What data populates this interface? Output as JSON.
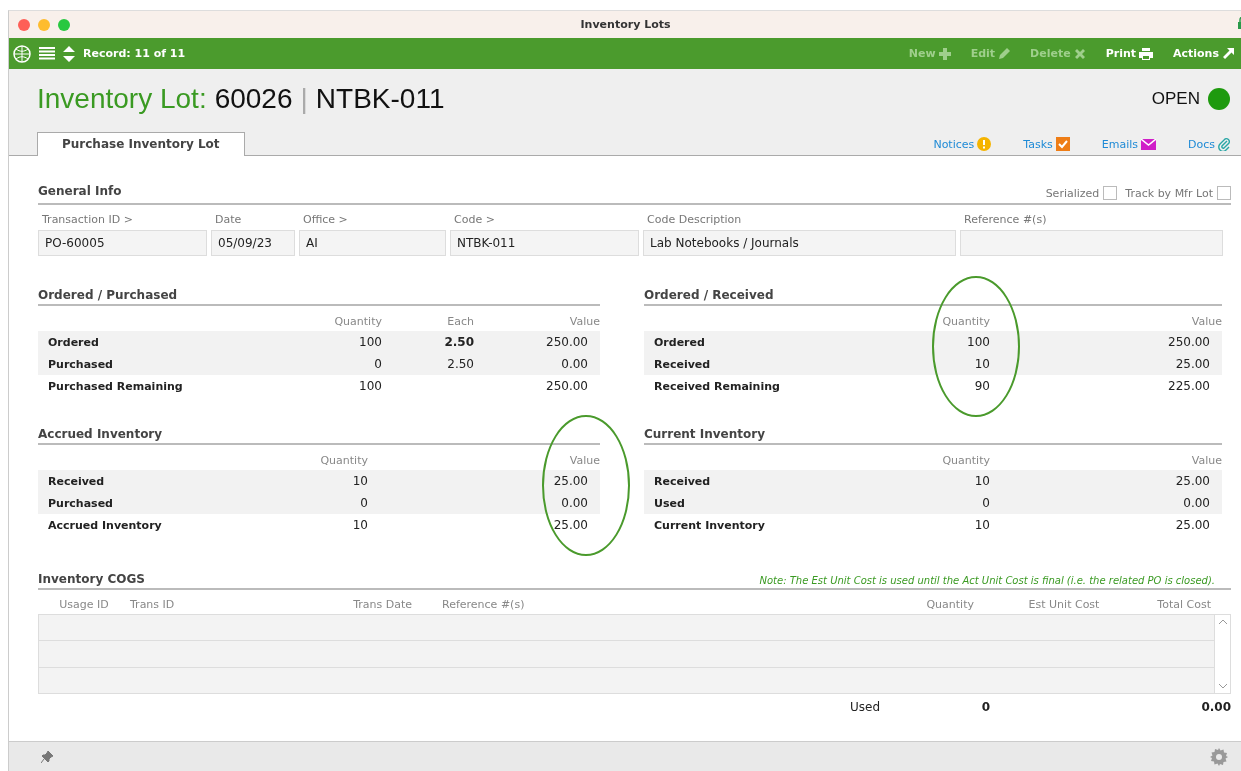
{
  "window": {
    "title": "Inventory Lots"
  },
  "toolbar": {
    "record": "Record: 11 of 11",
    "actions": [
      {
        "label": "New",
        "kind": "plus",
        "disabled": true
      },
      {
        "label": "Edit",
        "kind": "pencil",
        "disabled": true
      },
      {
        "label": "Delete",
        "kind": "cross",
        "disabled": true
      },
      {
        "label": "Print",
        "kind": "printer",
        "disabled": false
      },
      {
        "label": "Actions",
        "kind": "arrow",
        "disabled": false
      }
    ]
  },
  "header": {
    "prefix": "Inventory Lot:",
    "number": "60026",
    "separator": "|",
    "code": "NTBK-011",
    "status": "OPEN"
  },
  "tabs": [
    {
      "label": "Purchase Inventory Lot",
      "selected": true
    }
  ],
  "links": [
    {
      "label": "Notices",
      "kind": "notice"
    },
    {
      "label": "Tasks",
      "kind": "task"
    },
    {
      "label": "Emails",
      "kind": "email"
    },
    {
      "label": "Docs",
      "kind": "doc"
    }
  ],
  "general_info": {
    "title": "General Info",
    "checkboxes": [
      {
        "label": "Serialized",
        "checked": false
      },
      {
        "label": "Track by Mfr Lot",
        "checked": false
      }
    ],
    "fields": [
      {
        "label": "Transaction ID >",
        "value": "PO-60005"
      },
      {
        "label": "Date",
        "value": "05/09/23"
      },
      {
        "label": "Office >",
        "value": "AI"
      },
      {
        "label": "Code >",
        "value": "NTBK-011"
      },
      {
        "label": "Code Description",
        "value": "Lab Notebooks / Journals"
      },
      {
        "label": "Reference #(s)"
      }
    ]
  },
  "sections": [
    {
      "title": "Ordered / Purchased",
      "columns": [
        {
          "label": "Quantity",
          "circled": false
        },
        {
          "label": "Each",
          "circled": false
        },
        {
          "label": "Value",
          "circled": false
        }
      ],
      "rows": [
        {
          "label": "Ordered",
          "shaded": true,
          "cells": [
            {
              "text": "100",
              "bold": false
            },
            {
              "text": "2.50",
              "bold": true
            },
            {
              "text": "250.00",
              "bold": false
            }
          ]
        },
        {
          "label": "Purchased",
          "shaded": true,
          "cells": [
            {
              "text": "0",
              "bold": false
            },
            {
              "text": "2.50",
              "bold": false
            },
            {
              "text": "0.00",
              "bold": false
            }
          ]
        },
        {
          "label": "Purchased Remaining",
          "shaded": false,
          "cells": [
            {
              "text": "100",
              "bold": false
            },
            null,
            {
              "text": "250.00",
              "bold": false
            }
          ]
        }
      ]
    },
    {
      "title": "Ordered / Received",
      "columns": [
        {
          "label": "Quantity",
          "circled": true
        },
        {
          "label": "Value",
          "circled": false
        }
      ],
      "rows": [
        {
          "label": "Ordered",
          "shaded": true,
          "cells": [
            {
              "text": "100",
              "bold": false
            },
            {
              "text": "250.00",
              "bold": false
            }
          ]
        },
        {
          "label": "Received",
          "shaded": true,
          "cells": [
            {
              "text": "10",
              "bold": false
            },
            {
              "text": "25.00",
              "bold": false
            }
          ]
        },
        {
          "label": "Received Remaining",
          "shaded": false,
          "cells": [
            {
              "text": "90",
              "bold": false
            },
            {
              "text": "225.00",
              "bold": false
            }
          ]
        }
      ]
    },
    {
      "title": "Accrued Inventory",
      "columns": [
        {
          "label": "Quantity",
          "circled": false
        },
        {
          "label": "Value",
          "circled": true
        }
      ],
      "rows": [
        {
          "label": "Received",
          "shaded": true,
          "cells": [
            {
              "text": "10",
              "bold": false
            },
            {
              "text": "25.00",
              "bold": false
            }
          ]
        },
        {
          "label": "Purchased",
          "shaded": true,
          "cells": [
            {
              "text": "0",
              "bold": false
            },
            {
              "text": "0.00",
              "bold": false
            }
          ]
        },
        {
          "label": "Accrued Inventory",
          "shaded": false,
          "cells": [
            {
              "text": "10",
              "bold": false
            },
            {
              "text": "25.00",
              "bold": false
            }
          ]
        }
      ]
    },
    {
      "title": "Current Inventory",
      "columns": [
        {
          "label": "Quantity",
          "circled": false
        },
        {
          "label": "Value",
          "circled": false
        }
      ],
      "rows": [
        {
          "label": "Received",
          "shaded": true,
          "cells": [
            {
              "text": "10",
              "bold": false
            },
            {
              "text": "25.00",
              "bold": false
            }
          ]
        },
        {
          "label": "Used",
          "shaded": true,
          "cells": [
            {
              "text": "0",
              "bold": false
            },
            {
              "text": "0.00",
              "bold": false
            }
          ]
        },
        {
          "label": "Current Inventory",
          "shaded": false,
          "cells": [
            {
              "text": "10",
              "bold": false
            },
            {
              "text": "25.00",
              "bold": false
            }
          ]
        }
      ]
    }
  ],
  "cogs": {
    "title": "Inventory COGS",
    "note": "Note: The Est Unit Cost is used until the Act Unit Cost is final (i.e. the related PO is closed).",
    "columns": [
      "Usage ID",
      "Trans ID",
      "Trans Date",
      "Reference #(s)",
      "Quantity",
      "Est Unit Cost",
      "Total Cost"
    ],
    "totals": {
      "label": "Used",
      "quantity": "0",
      "total": "0.00"
    }
  }
}
